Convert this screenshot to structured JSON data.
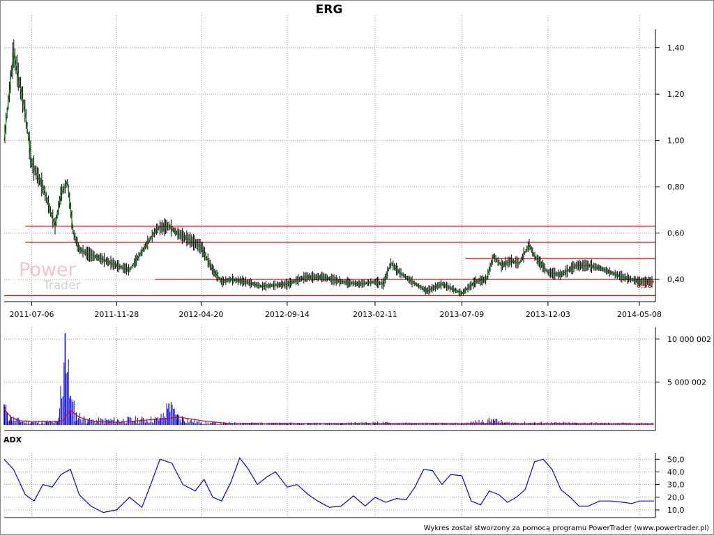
{
  "watermark": {
    "word1": "Power",
    "word2": "Trader"
  },
  "footer": "Wykres został stworzony za pomocą programu PowerTrader (www.powertrader.pl)",
  "chart_data": [
    {
      "type": "line",
      "title": "ERG",
      "x_tick_labels": [
        "2011-07-06",
        "2011-11-28",
        "2012-04-20",
        "2012-09-14",
        "2013-02-11",
        "2013-07-09",
        "2013-12-03",
        "2014-05-08"
      ],
      "y_tick_labels": [
        "1,40",
        "1,20",
        "1,00",
        "0,80",
        "0,60",
        "0,40"
      ],
      "ylim": [
        0.31,
        1.48
      ],
      "y_ticks": [
        1.4,
        1.2,
        1.0,
        0.8,
        0.6,
        0.4
      ],
      "grid": true,
      "x": [
        "2011-05-20",
        "2011-06-05",
        "2011-06-25",
        "2011-07-06",
        "2011-07-25",
        "2011-08-15",
        "2011-08-25",
        "2011-09-05",
        "2011-09-15",
        "2011-09-25",
        "2011-10-10",
        "2011-11-01",
        "2011-11-28",
        "2011-12-20",
        "2012-01-10",
        "2012-02-05",
        "2012-02-25",
        "2012-03-10",
        "2012-04-01",
        "2012-04-20",
        "2012-05-10",
        "2012-05-25",
        "2012-06-10",
        "2012-07-05",
        "2012-08-01",
        "2012-09-14",
        "2012-10-15",
        "2012-11-15",
        "2012-12-15",
        "2013-01-15",
        "2013-02-11",
        "2013-02-25",
        "2013-03-10",
        "2013-03-25",
        "2013-04-15",
        "2013-05-10",
        "2013-06-05",
        "2013-07-09",
        "2013-08-01",
        "2013-08-20",
        "2013-09-01",
        "2013-09-15",
        "2013-10-01",
        "2013-10-15",
        "2013-11-01",
        "2013-11-10",
        "2013-12-03",
        "2013-12-25",
        "2014-01-20",
        "2014-02-10",
        "2014-03-01",
        "2014-03-20",
        "2014-04-10",
        "2014-04-25",
        "2014-05-08",
        "2014-06-02"
      ],
      "series": [
        {
          "color": "#008000",
          "values": [
            1.0,
            1.38,
            1.12,
            0.9,
            0.8,
            0.63,
            0.77,
            0.82,
            0.6,
            0.53,
            0.51,
            0.49,
            0.46,
            0.44,
            0.52,
            0.62,
            0.63,
            0.6,
            0.57,
            0.54,
            0.44,
            0.39,
            0.4,
            0.39,
            0.37,
            0.38,
            0.41,
            0.41,
            0.39,
            0.38,
            0.39,
            0.38,
            0.47,
            0.43,
            0.39,
            0.35,
            0.38,
            0.34,
            0.39,
            0.4,
            0.5,
            0.46,
            0.48,
            0.47,
            0.55,
            0.5,
            0.43,
            0.42,
            0.46,
            0.46,
            0.45,
            0.43,
            0.41,
            0.4,
            0.39,
            0.39
          ]
        }
      ],
      "price_range_bars": true,
      "last_value_label": "0,33",
      "horizontal_lines": [
        {
          "value": 0.63,
          "from": "2011-06-25",
          "color": "#e00000"
        },
        {
          "value": 0.56,
          "from": "2011-06-25",
          "color": "#e00000"
        },
        {
          "value": 0.4,
          "from": "2012-02-01",
          "color": "#e00000"
        },
        {
          "value": 0.49,
          "from": "2013-07-15",
          "color": "#e00000"
        },
        {
          "value": 0.33,
          "from": "2011-05-20",
          "color": "#e00000"
        }
      ]
    },
    {
      "type": "bar",
      "name": "volume",
      "y_tick_labels": [
        "10 000 002",
        "5 000 002"
      ],
      "y_ticks": [
        10000002,
        5000002
      ],
      "ylim": [
        0,
        11200000
      ],
      "x": [
        "2011-05-20",
        "2011-05-25",
        "2011-06-01",
        "2011-06-15",
        "2011-07-06",
        "2011-08-01",
        "2011-08-20",
        "2011-09-01",
        "2011-09-10",
        "2011-09-20",
        "2011-10-10",
        "2012-02-10",
        "2012-02-25",
        "2012-03-10",
        "2012-03-20",
        "2012-04-20",
        "2012-06-01",
        "2012-09-14",
        "2012-12-15",
        "2013-02-11",
        "2013-04-15",
        "2013-07-09",
        "2013-09-01",
        "2013-09-20",
        "2013-11-10",
        "2014-01-20",
        "2014-03-10",
        "2014-05-08"
      ],
      "values": [
        2400000,
        1500000,
        900000,
        600000,
        350000,
        450000,
        380000,
        10700000,
        3400000,
        1400000,
        600000,
        800000,
        2500000,
        1200000,
        900000,
        300000,
        250000,
        200000,
        200000,
        300000,
        200000,
        180000,
        700000,
        300000,
        280000,
        250000,
        220000,
        200000
      ],
      "series": [
        {
          "color": "#e00000",
          "x": [
            "2011-05-20",
            "2011-06-01",
            "2011-06-15",
            "2011-07-06",
            "2011-08-10",
            "2011-08-28",
            "2011-09-10",
            "2011-09-25",
            "2011-10-20",
            "2011-12-01",
            "2012-02-10",
            "2012-03-15",
            "2012-04-20",
            "2012-06-01",
            "2014-06-02"
          ],
          "values": [
            1800000,
            900000,
            500000,
            400000,
            350000,
            500000,
            1700000,
            900000,
            400000,
            300000,
            700000,
            900000,
            500000,
            200000,
            150000
          ]
        }
      ]
    },
    {
      "type": "line",
      "title": "ADX",
      "y_tick_labels": [
        "50,0",
        "40,0",
        "30,0",
        "20,0",
        "10,0"
      ],
      "y_ticks": [
        50,
        40,
        30,
        20,
        10
      ],
      "ylim": [
        5,
        54
      ],
      "grid": true,
      "x": [
        "2011-05-20",
        "2011-06-05",
        "2011-06-25",
        "2011-07-10",
        "2011-07-25",
        "2011-08-10",
        "2011-08-25",
        "2011-09-10",
        "2011-09-25",
        "2011-10-15",
        "2011-11-05",
        "2011-11-28",
        "2011-12-20",
        "2012-01-10",
        "2012-01-25",
        "2012-02-10",
        "2012-03-01",
        "2012-03-20",
        "2012-04-10",
        "2012-04-25",
        "2012-05-10",
        "2012-05-25",
        "2012-06-10",
        "2012-06-25",
        "2012-07-10",
        "2012-07-25",
        "2012-08-10",
        "2012-08-25",
        "2012-09-14",
        "2012-10-01",
        "2012-10-20",
        "2012-11-05",
        "2012-11-25",
        "2012-12-15",
        "2013-01-05",
        "2013-01-25",
        "2013-02-11",
        "2013-03-01",
        "2013-03-20",
        "2013-04-05",
        "2013-04-20",
        "2013-05-05",
        "2013-05-20",
        "2013-06-05",
        "2013-06-20",
        "2013-07-09",
        "2013-07-25",
        "2013-08-10",
        "2013-08-25",
        "2013-09-10",
        "2013-09-25",
        "2013-10-10",
        "2013-10-25",
        "2013-11-10",
        "2013-11-25",
        "2013-12-10",
        "2013-12-25",
        "2014-01-10",
        "2014-01-25",
        "2014-02-10",
        "2014-03-01",
        "2014-03-20",
        "2014-04-10",
        "2014-04-25",
        "2014-05-08",
        "2014-06-02"
      ],
      "series": [
        {
          "color": "#0000e0",
          "values": [
            50,
            42,
            22,
            17,
            30,
            28,
            38,
            42,
            22,
            13,
            8,
            10,
            20,
            12,
            30,
            50,
            47,
            30,
            25,
            34,
            20,
            17,
            32,
            51,
            42,
            30,
            36,
            40,
            28,
            30,
            22,
            17,
            12,
            13,
            21,
            13,
            20,
            16,
            19,
            18,
            28,
            42,
            41,
            30,
            38,
            37,
            17,
            14,
            25,
            22,
            16,
            20,
            26,
            48,
            50,
            42,
            26,
            20,
            13,
            13,
            17,
            17,
            16,
            15,
            17,
            17
          ]
        }
      ]
    }
  ]
}
